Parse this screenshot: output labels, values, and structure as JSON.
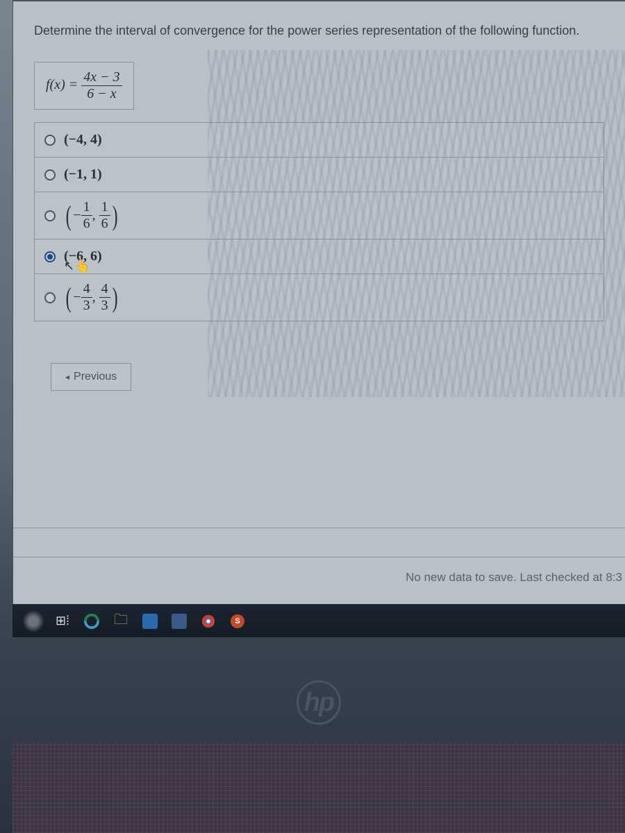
{
  "question": {
    "prompt": "Determine the interval of convergence for the power series representation of the following function.",
    "formula_lhs": "f(x) =",
    "formula_num": "4x − 3",
    "formula_den": "6 − x"
  },
  "options": [
    {
      "id": "opt-a",
      "label_plain": "(−4, 4)",
      "selected": false,
      "type": "plain"
    },
    {
      "id": "opt-b",
      "label_plain": "(−1, 1)",
      "selected": false,
      "type": "plain"
    },
    {
      "id": "opt-c",
      "type": "frac",
      "neg_num": "1",
      "neg_den": "6",
      "pos_num": "1",
      "pos_den": "6",
      "selected": false
    },
    {
      "id": "opt-d",
      "label_plain": "(−6, 6)",
      "selected": true,
      "type": "plain",
      "cursor": true
    },
    {
      "id": "opt-e",
      "type": "frac",
      "neg_num": "4",
      "neg_den": "3",
      "pos_num": "4",
      "pos_den": "3",
      "selected": false
    }
  ],
  "nav": {
    "previous": "Previous",
    "prev_arrow": "◂"
  },
  "status_text": "No new data to save. Last checked at 8:3",
  "logo": "hp",
  "chart_data": null
}
